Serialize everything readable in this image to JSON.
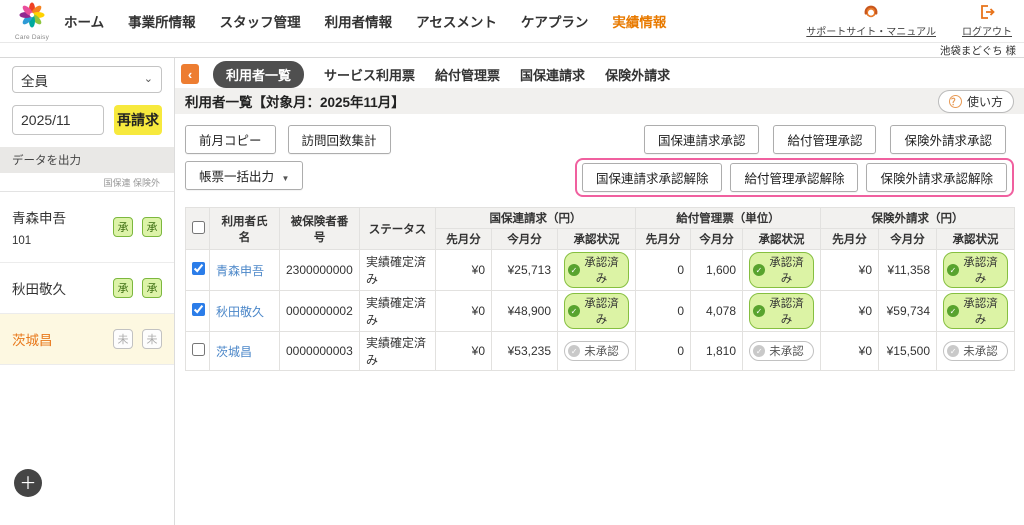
{
  "header": {
    "brand": "Care Daisy",
    "menu": [
      {
        "label": "ホーム",
        "active": false
      },
      {
        "label": "事業所情報",
        "active": false
      },
      {
        "label": "スタッフ管理",
        "active": false
      },
      {
        "label": "利用者情報",
        "active": false
      },
      {
        "label": "アセスメント",
        "active": false
      },
      {
        "label": "ケアプラン",
        "active": false
      },
      {
        "label": "実績情報",
        "active": true
      }
    ],
    "support_link": "サポートサイト・マニュアル",
    "logout_link": "ログアウト",
    "user_name": "池袋まどぐち 様"
  },
  "sidebar": {
    "filter_select": "全員",
    "month_input": "2025/11",
    "rebill_button": "再請求",
    "export_label": "データを出力",
    "badge_col_labels": "国保連 保険外",
    "users": [
      {
        "name": "青森申吾",
        "code": "101",
        "badge1": "承",
        "badge2": "承"
      },
      {
        "name": "秋田敬久",
        "code": "",
        "badge1": "承",
        "badge2": "承"
      },
      {
        "name": "茨城昌",
        "code": "",
        "badge1": "未",
        "badge2": "未"
      }
    ]
  },
  "tabs": {
    "items": [
      "利用者一覧",
      "サービス利用票",
      "給付管理票",
      "国保連請求",
      "保険外請求"
    ]
  },
  "title_bar": {
    "title": "利用者一覧【対象月：2025年11月】",
    "help_button": "使い方"
  },
  "toolbar": {
    "prev_month_copy": "前月コピー",
    "visit_count": "訪問回数集計",
    "batch_output": "帳票一括出力",
    "approve_buttons": [
      "国保連請求承認",
      "給付管理承認",
      "保険外請求承認"
    ],
    "unapprove_buttons": [
      "国保連請求承認解除",
      "給付管理承認解除",
      "保険外請求承認解除"
    ]
  },
  "table": {
    "headers": {
      "name": "利用者氏名",
      "insured_no": "被保険者番号",
      "status": "ステータス",
      "groups": [
        "国保連請求（円）",
        "給付管理票（単位）",
        "保険外請求（円）"
      ],
      "sub": [
        "先月分",
        "今月分",
        "承認状況"
      ]
    },
    "rows": [
      {
        "name": "青森申吾",
        "insured_no": "2300000000",
        "status": "実績確定済み",
        "kokuho_prev": "¥0",
        "kokuho_cur": "¥25,713",
        "kokuho_status": "承認済み",
        "kyufu_prev": "0",
        "kyufu_cur": "1,600",
        "kyufu_status": "承認済み",
        "hokengai_prev": "¥0",
        "hokengai_cur": "¥11,358",
        "hokengai_status": "承認済み"
      },
      {
        "name": "秋田敬久",
        "insured_no": "0000000002",
        "status": "実績確定済み",
        "kokuho_prev": "¥0",
        "kokuho_cur": "¥48,900",
        "kokuho_status": "承認済み",
        "kyufu_prev": "0",
        "kyufu_cur": "4,078",
        "kyufu_status": "承認済み",
        "hokengai_prev": "¥0",
        "hokengai_cur": "¥59,734",
        "hokengai_status": "承認済み"
      },
      {
        "name": "茨城昌",
        "insured_no": "0000000003",
        "status": "実績確定済み",
        "kokuho_prev": "¥0",
        "kokuho_cur": "¥53,235",
        "kokuho_status": "未承認",
        "kyufu_prev": "0",
        "kyufu_cur": "1,810",
        "kyufu_status": "未承認",
        "hokengai_prev": "¥0",
        "hokengai_cur": "¥15,500",
        "hokengai_status": "未承認"
      }
    ]
  },
  "icons": {
    "back": "‹",
    "select_caret": "⌄",
    "caret_down": "▼",
    "check": "✓",
    "plus": "＋",
    "help_q": "？"
  },
  "colors": {
    "accent_orange": "#e87a00",
    "rebill_yellow": "#f7e93d",
    "approved_green_border": "#86bf40",
    "approved_green_bg": "#dcf3a5",
    "highlight_pink": "#f0609f",
    "link_blue": "#4a86c8",
    "active_tab_gray": "#4f4f4f",
    "selected_row_cream": "#fdf8e1"
  }
}
